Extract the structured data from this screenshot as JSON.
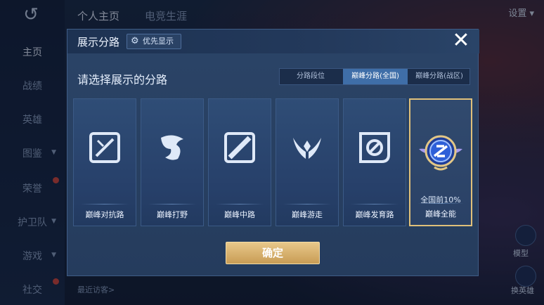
{
  "background": {
    "back_icon": "back-arrow-icon",
    "top_tabs": [
      "个人主页",
      "电竞生涯"
    ],
    "settings_label": "设置",
    "nav_items": [
      {
        "label": "主页",
        "badge": false,
        "caret": false
      },
      {
        "label": "战绩",
        "badge": false,
        "caret": false
      },
      {
        "label": "英雄",
        "badge": false,
        "caret": false
      },
      {
        "label": "图鉴",
        "badge": false,
        "caret": true
      },
      {
        "label": "荣誉",
        "badge": true,
        "caret": false
      },
      {
        "label": "护卫队",
        "badge": false,
        "caret": true
      },
      {
        "label": "游戏",
        "badge": false,
        "caret": true
      },
      {
        "label": "社交",
        "badge": true,
        "caret": true
      }
    ],
    "recent_visitors_label": "最近访客>",
    "right_buttons": [
      "模型",
      "换英雄"
    ]
  },
  "modal": {
    "title": "展示分路",
    "priority_button_label": "优先显示",
    "close_icon": "close-icon",
    "prompt": "请选择展示的分路",
    "segment_tabs": [
      {
        "label": "分路段位",
        "active": false
      },
      {
        "label": "巅峰分路(全国)",
        "active": true
      },
      {
        "label": "巅峰分路(战区)",
        "active": false
      }
    ],
    "cards": [
      {
        "label": "巅峰对抗路",
        "icon": "sword-icon",
        "rank": "",
        "selected": false
      },
      {
        "label": "巅峰打野",
        "icon": "dragon-icon",
        "rank": "",
        "selected": false
      },
      {
        "label": "巅峰中路",
        "icon": "staff-icon",
        "rank": "",
        "selected": false
      },
      {
        "label": "巅峰游走",
        "icon": "wings-icon",
        "rank": "",
        "selected": false
      },
      {
        "label": "巅峰发育路",
        "icon": "target-icon",
        "rank": "",
        "selected": false
      },
      {
        "label": "巅峰全能",
        "icon": "allround-emblem-icon",
        "rank": "全国前10%",
        "selected": true
      }
    ],
    "confirm_label": "确定"
  },
  "colors": {
    "accent_gold": "#e0c07a",
    "active_tab": "#3f6ea8",
    "modal_bg": "#2b4467"
  }
}
